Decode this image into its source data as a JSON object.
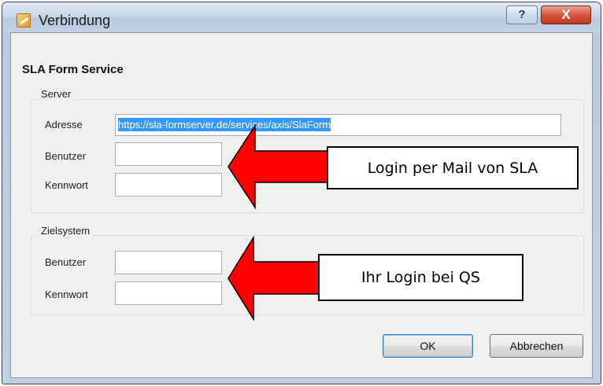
{
  "window": {
    "title": "Verbindung",
    "help_glyph": "?",
    "close_glyph": "X"
  },
  "heading": "SLA Form Service",
  "server_group": {
    "legend": "Server",
    "address_label": "Adresse",
    "address_value": "https://sla-formserver.de/services/axis/SlaForm",
    "user_label": "Benutzer",
    "user_value": "",
    "password_label": "Kennwort",
    "password_value": ""
  },
  "target_group": {
    "legend": "Zielsystem",
    "user_label": "Benutzer",
    "user_value": "",
    "password_label": "Kennwort",
    "password_value": ""
  },
  "annotations": {
    "server_callout": "Login per Mail von SLA",
    "target_callout": "Ihr Login bei QS",
    "arrow_color": "#ff0000"
  },
  "buttons": {
    "ok": "OK",
    "cancel": "Abbrechen"
  },
  "icons": {
    "app": "pencil-form-icon",
    "help": "question-mark-icon",
    "close": "close-icon"
  }
}
